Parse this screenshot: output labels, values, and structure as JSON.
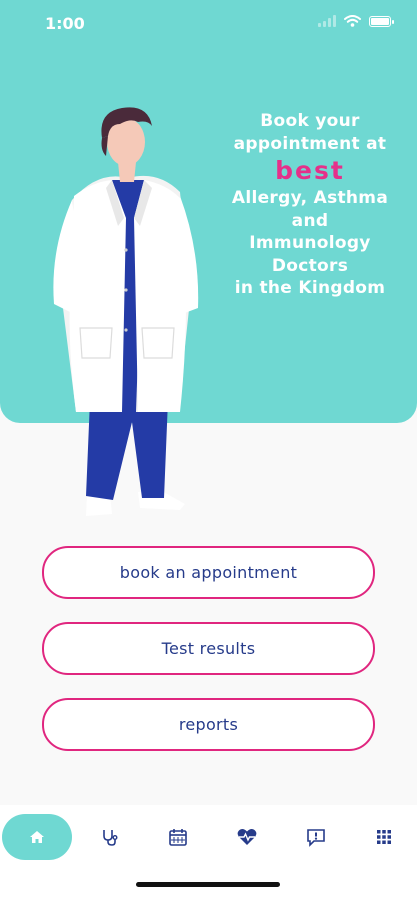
{
  "status_bar": {
    "time": "1:00"
  },
  "hero": {
    "line1": "Book your",
    "line2": "appointment at",
    "highlight": "best",
    "line3": "Allergy, Asthma",
    "line4": "and",
    "line5": "Immunology",
    "line6": "Doctors",
    "line7": "in the Kingdom"
  },
  "buttons": {
    "book": "book an appointment",
    "tests": "Test results",
    "reports": "reports"
  },
  "tabbar": {
    "items": [
      {
        "icon": "home-icon"
      },
      {
        "icon": "stethoscope-icon"
      },
      {
        "icon": "calendar-icon"
      },
      {
        "icon": "heart-pulse-icon"
      },
      {
        "icon": "alert-message-icon"
      },
      {
        "icon": "grid-menu-icon"
      }
    ]
  },
  "colors": {
    "accent": "#6fd8d2",
    "pink": "#e0267f",
    "navy": "#263b8a"
  }
}
